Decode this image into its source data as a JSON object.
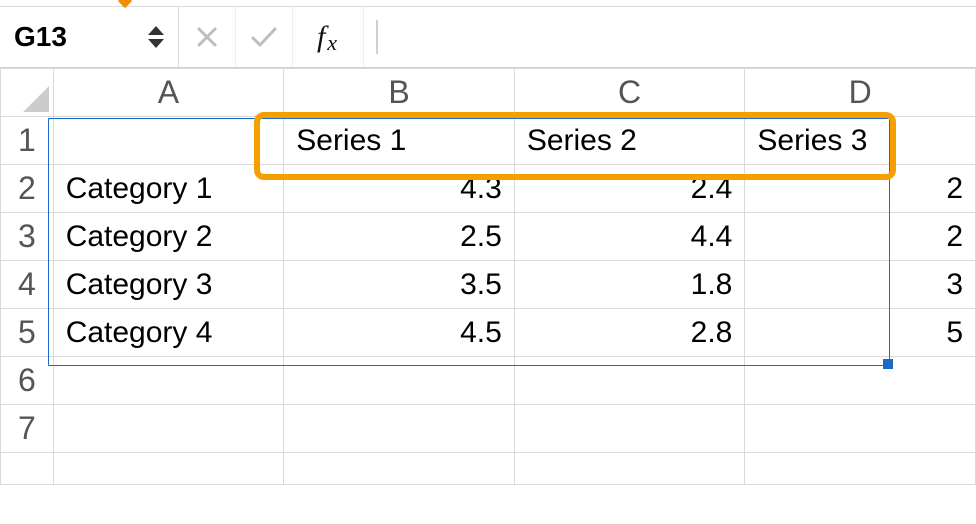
{
  "name_box": {
    "value": "G13"
  },
  "formula_bar": {
    "value": ""
  },
  "columns": [
    "A",
    "B",
    "C",
    "D"
  ],
  "rows": [
    "1",
    "2",
    "3",
    "4",
    "5",
    "6",
    "7"
  ],
  "headers": {
    "B": "Series 1",
    "C": "Series 2",
    "D": "Series 3"
  },
  "categories": [
    "Category 1",
    "Category 2",
    "Category 3",
    "Category 4"
  ],
  "data": {
    "B": [
      "4.3",
      "2.5",
      "3.5",
      "4.5"
    ],
    "C": [
      "2.4",
      "4.4",
      "1.8",
      "2.8"
    ],
    "D": [
      "2",
      "2",
      "3",
      "5"
    ]
  },
  "chart_data": {
    "type": "table",
    "categories": [
      "Category 1",
      "Category 2",
      "Category 3",
      "Category 4"
    ],
    "series": [
      {
        "name": "Series 1",
        "values": [
          4.3,
          2.5,
          3.5,
          4.5
        ]
      },
      {
        "name": "Series 2",
        "values": [
          2.4,
          4.4,
          1.8,
          2.8
        ]
      },
      {
        "name": "Series 3",
        "values": [
          2,
          2,
          3,
          5
        ]
      }
    ]
  }
}
